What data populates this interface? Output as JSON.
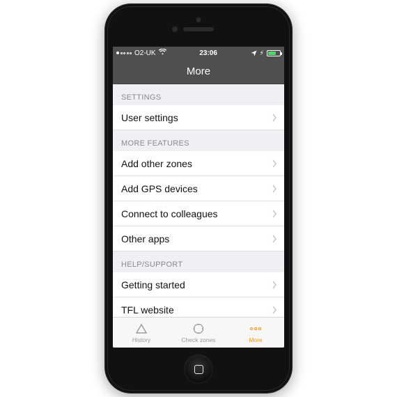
{
  "statusbar": {
    "carrier": "O2-UK",
    "time": "23:06"
  },
  "header": {
    "title": "More"
  },
  "sections": {
    "settings": {
      "title": "SETTINGS",
      "items": [
        {
          "label": "User settings"
        }
      ]
    },
    "features": {
      "title": "MORE FEATURES",
      "items": [
        {
          "label": "Add other zones"
        },
        {
          "label": "Add GPS devices"
        },
        {
          "label": "Connect to colleagues"
        },
        {
          "label": "Other apps"
        }
      ]
    },
    "help": {
      "title": "HELP/SUPPORT",
      "items": [
        {
          "label": "Getting started"
        },
        {
          "label": "TFL website"
        }
      ]
    }
  },
  "tabs": {
    "history": "History",
    "check": "Check zones",
    "more": "More"
  }
}
